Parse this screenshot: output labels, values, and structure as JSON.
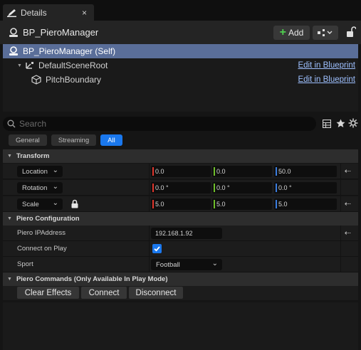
{
  "tab": {
    "title": "Details",
    "close": "×"
  },
  "header": {
    "actor_name": "BP_PieroManager",
    "add_label": "Add"
  },
  "tree": {
    "items": [
      {
        "label": "BP_PieroManager (Self)",
        "link": ""
      },
      {
        "label": "DefaultSceneRoot",
        "link": "Edit in Blueprint"
      },
      {
        "label": "PitchBoundary",
        "link": "Edit in Blueprint"
      }
    ]
  },
  "search": {
    "placeholder": "Search"
  },
  "filters": [
    {
      "label": "General",
      "active": false
    },
    {
      "label": "Streaming",
      "active": false
    },
    {
      "label": "All",
      "active": true
    }
  ],
  "transform": {
    "category": "Transform",
    "rows": [
      {
        "label": "Location",
        "x": "0.0",
        "y": "0.0",
        "z": "50.0"
      },
      {
        "label": "Rotation",
        "x": "0.0 °",
        "y": "0.0 °",
        "z": "0.0 °"
      },
      {
        "label": "Scale",
        "x": "5.0",
        "y": "5.0",
        "z": "5.0"
      }
    ]
  },
  "piero_config": {
    "category": "Piero Configuration",
    "ip_label": "Piero IPAddress",
    "ip_value": "192.168.1.92",
    "connect_label": "Connect on Play",
    "connect_checked": true,
    "sport_label": "Sport",
    "sport_value": "Football"
  },
  "piero_commands": {
    "category": "Piero Commands  (Only Available In Play Mode)",
    "buttons": [
      "Clear Effects",
      "Connect",
      "Disconnect"
    ]
  },
  "colors": {
    "accent": "#1a78ee",
    "selection": "#5a6e99",
    "axis_x": "#e0352b",
    "axis_y": "#6fbf2a",
    "axis_z": "#3a7de0",
    "add_plus": "#4fcf4f"
  }
}
